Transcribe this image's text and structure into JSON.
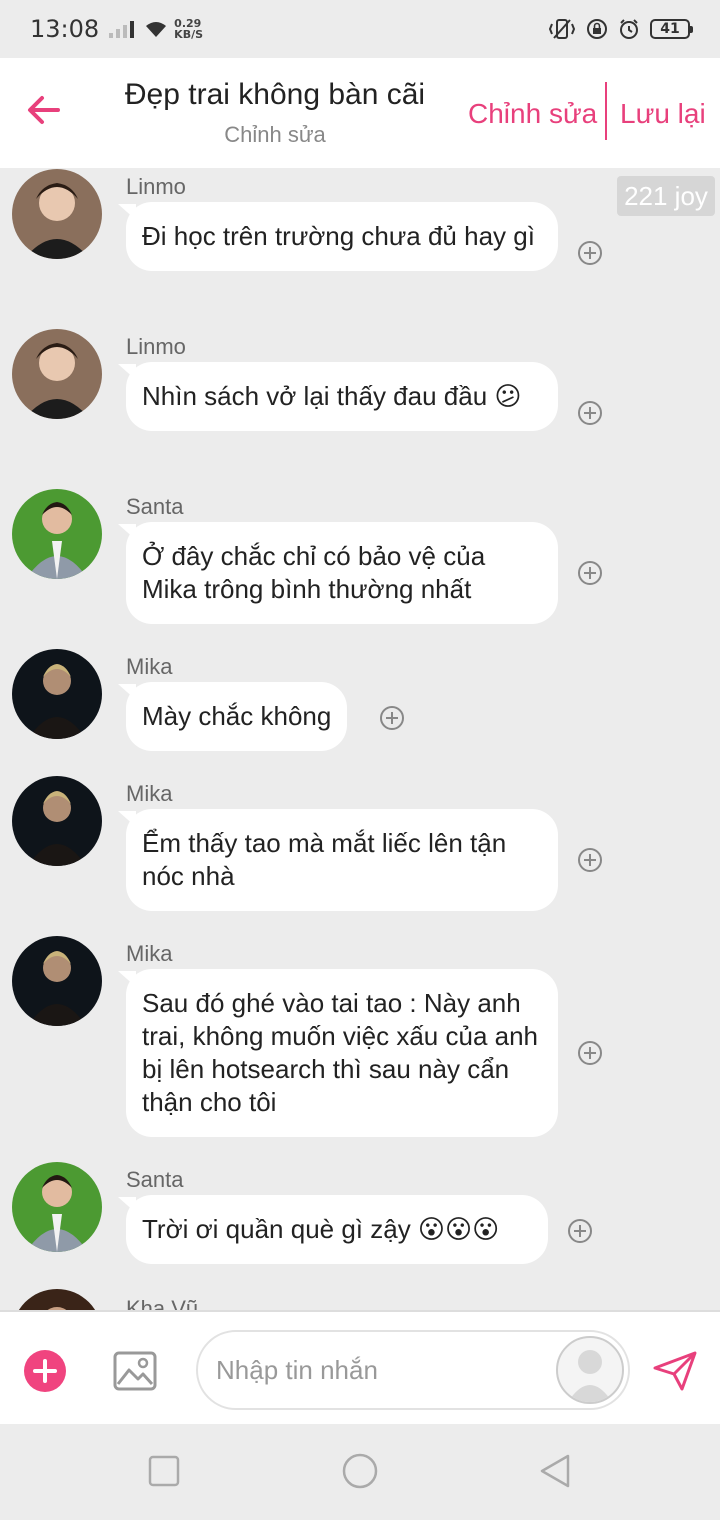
{
  "status_bar": {
    "time": "13:08",
    "net_speed_value": "0.29",
    "net_speed_unit": "KB/S",
    "battery": "41"
  },
  "header": {
    "title": "Đẹp trai không bàn cãi",
    "subtitle": "Chỉnh sửa",
    "edit_label": "Chỉnh sửa",
    "save_label": "Lưu lại"
  },
  "joy_badge": "221 joy",
  "messages": [
    {
      "sender": "Linmo",
      "text": "Đi học trên trường chưa đủ hay gì"
    },
    {
      "sender": "Linmo",
      "text": "Nhìn sách vở lại thấy đau đầu 😕"
    },
    {
      "sender": "Santa",
      "text": "Ở đây chắc chỉ có bảo vệ của Mika trông bình thường nhất"
    },
    {
      "sender": "Mika",
      "text": "Mày chắc không"
    },
    {
      "sender": "Mika",
      "text": "Ểm thấy tao mà mắt liếc lên tận nóc nhà"
    },
    {
      "sender": "Mika",
      "text": "Sau đó ghé vào tai tao : Này anh trai, không muốn việc xấu của anh bị lên hotsearch thì sau này cẩn thận cho tôi"
    },
    {
      "sender": "Santa",
      "text": "Trời ơi quần què gì zậy 😮😮😮"
    },
    {
      "sender": "Kha Vũ",
      "text": ""
    }
  ],
  "input": {
    "placeholder": "Nhập tin nhắn"
  },
  "colors": {
    "accent": "#e8407c",
    "background": "#ececec",
    "bubble": "#ffffff"
  },
  "icons": [
    "back-arrow-icon",
    "add-icon",
    "image-icon",
    "send-icon",
    "plus-circle-icon",
    "recent-apps-icon",
    "home-icon",
    "back-nav-icon"
  ]
}
